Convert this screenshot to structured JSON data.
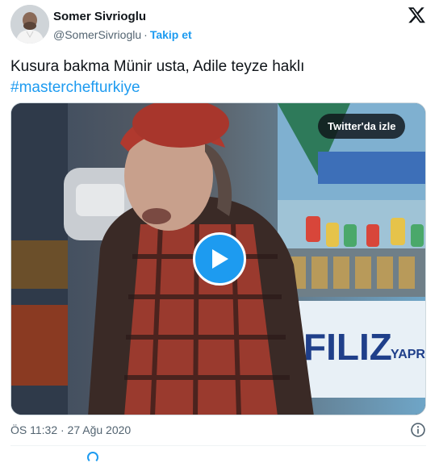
{
  "author": {
    "name": "Somer Sivrioglu",
    "handle": "@SomerSivrioglu",
    "separator": "·",
    "follow_label": "Takip et",
    "avatar_icon": "person-avatar"
  },
  "brand_icon": "x-logo-icon",
  "tweet": {
    "text_line1": "Kusura bakma Münir usta, Adile teyze haklı",
    "hashtag": "#masterchefturkiye"
  },
  "media": {
    "watch_label": "Twitter'da izle",
    "play_icon": "play-icon",
    "sign_text": "FILIZ",
    "sign_text2": "YAPRA"
  },
  "footer": {
    "timestamp": "ÖS 11:32 · 27 Ağu 2020",
    "info_icon": "info-icon"
  },
  "colors": {
    "accent": "#1d9bf0",
    "text": "#0f1419",
    "muted": "#536471",
    "border": "#cfd9de"
  }
}
